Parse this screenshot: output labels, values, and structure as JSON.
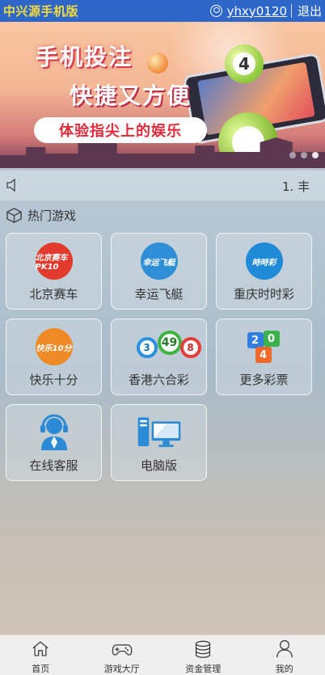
{
  "header": {
    "brand": "中兴源手机版",
    "username": "yhxy0120",
    "logout_label": "退出"
  },
  "banner": {
    "headline_1": "手机投注",
    "headline_2": "快捷又方便",
    "tagline": "体验指尖上的娱乐",
    "ball_number": "4"
  },
  "notice": {
    "text": "1. 丰"
  },
  "section": {
    "title": "热门游戏"
  },
  "games": [
    {
      "label": "北京赛车",
      "logo_text": "北京赛车 PK10"
    },
    {
      "label": "幸运飞艇",
      "logo_text": "幸运飞艇"
    },
    {
      "label": "重庆时时彩",
      "logo_text": "時時彩"
    },
    {
      "label": "快乐十分",
      "logo_text": "快乐10分"
    },
    {
      "label": "香港六合彩",
      "balls": [
        "3",
        "49",
        "8"
      ]
    },
    {
      "label": "更多彩票",
      "cards": [
        "2",
        "0",
        "4"
      ]
    },
    {
      "label": "在线客服"
    },
    {
      "label": "电脑版"
    }
  ],
  "bottom_nav": [
    {
      "label": "首页",
      "icon": "home-icon"
    },
    {
      "label": "游戏大厅",
      "icon": "gamepad-icon"
    },
    {
      "label": "资金管理",
      "icon": "coins-icon"
    },
    {
      "label": "我的",
      "icon": "user-icon"
    }
  ],
  "colors": {
    "header_bg": "#2f67c9",
    "brand": "#f6dc3b",
    "tagline": "#e02b3a"
  }
}
